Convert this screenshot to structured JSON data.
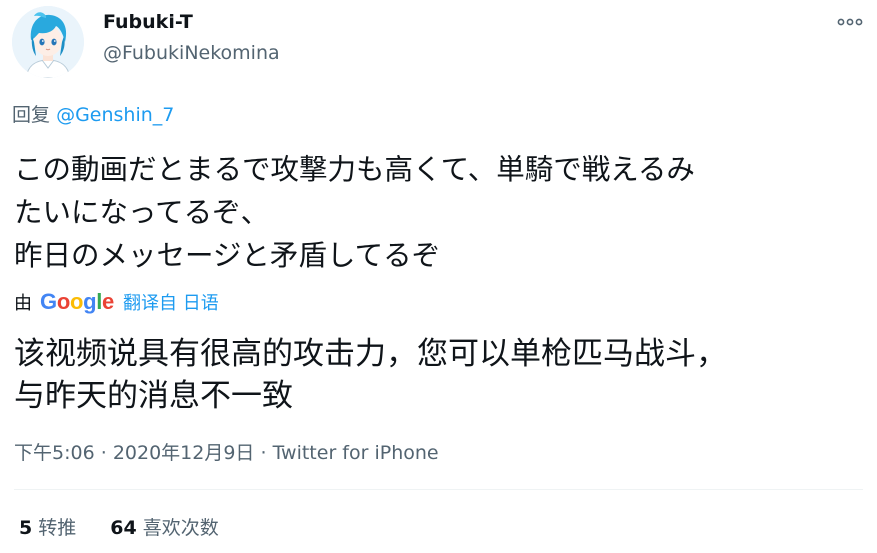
{
  "author": {
    "name": "Fubuki-T",
    "handle": "@FubukiNekomina",
    "avatar_icon": "avatar-anime-character"
  },
  "more_icon": "more-horizontal-icon",
  "reply": {
    "prefix": "回复",
    "to": "@Genshin_7"
  },
  "body": {
    "lines": [
      "この動画だとまるで攻撃力も高くて、単騎で戦えるみ",
      "たいになってるぞ、",
      "昨日のメッセージと矛盾してるぞ"
    ]
  },
  "translation_source": {
    "by": "由",
    "engine": "Google",
    "from_label": "翻译自 日语",
    "google_colors": [
      "#4285F4",
      "#EA4335",
      "#FBBC05",
      "#4285F4",
      "#34A853",
      "#EA4335"
    ]
  },
  "translation": {
    "lines": [
      "该视频说具有很高的攻击力，您可以单枪匹马战斗，",
      "与昨天的消息不一致"
    ]
  },
  "meta": {
    "time": "下午5:06",
    "separator": "·",
    "date": "2020年12月9日",
    "client": "Twitter for iPhone"
  },
  "stats": {
    "retweets": {
      "count": "5",
      "label": "转推"
    },
    "likes": {
      "count": "64",
      "label": "喜欢次数"
    }
  },
  "colors": {
    "accent": "#1d9bf0",
    "secondary_text": "#536471",
    "primary_text": "#0f1419"
  }
}
